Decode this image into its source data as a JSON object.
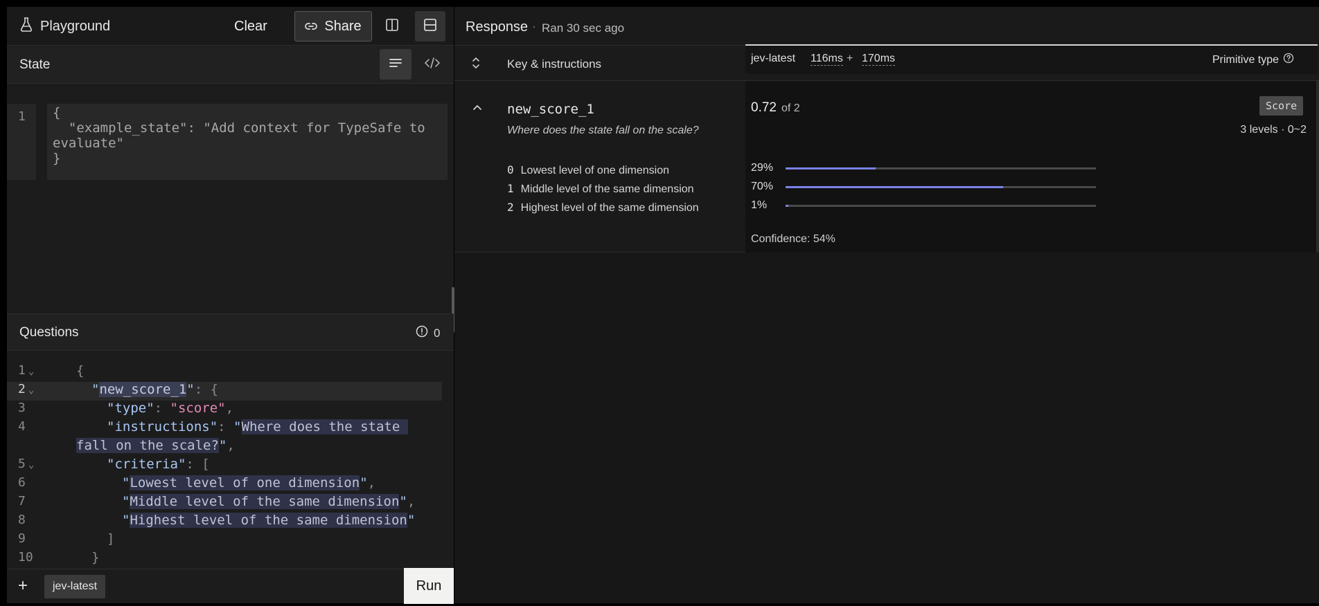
{
  "topbar": {
    "app_title": "Playground",
    "clear_label": "Clear",
    "share_label": "Share"
  },
  "state": {
    "title": "State",
    "line_number": "1",
    "lines": [
      "{",
      "  \"example_state\": \"Add context for TypeSafe to",
      "evaluate\"",
      "}"
    ]
  },
  "questions": {
    "title": "Questions",
    "issue_count": "0",
    "line_numbers": [
      "1",
      "2",
      "3",
      "4",
      "",
      "5",
      "6",
      "7",
      "8",
      "9",
      "10"
    ]
  },
  "bottombar": {
    "add_label": "+",
    "model_chip": "jev-latest",
    "run_label": "Run"
  },
  "response": {
    "title": "Response",
    "separator": "·",
    "ran": "Ran 30 sec ago",
    "key_header": "Key & instructions",
    "model_name": "jev-latest",
    "latency_a": "116ms",
    "latency_plus": "+",
    "latency_b": "170ms",
    "primitive_type_label": "Primitive type"
  },
  "question_row": {
    "key": "new_score_1",
    "instructions": "Where does the state fall on the scale?",
    "criteria": [
      {
        "index": "0",
        "label": "Lowest level of one dimension"
      },
      {
        "index": "1",
        "label": "Middle level of the same dimension"
      },
      {
        "index": "2",
        "label": "Highest level of the same dimension"
      }
    ],
    "score_value": "0.72",
    "score_of": "of 2",
    "badge": "Score",
    "levels_text": "3 levels · 0~2",
    "distribution": [
      {
        "label": "29%",
        "value": 0.29
      },
      {
        "label": "70%",
        "value": 0.7
      },
      {
        "label": "1%",
        "value": 0.01
      }
    ],
    "confidence": "Confidence: 54%"
  },
  "colors": {
    "accent_bar": "#7b83e8",
    "string": "#e58ab4",
    "key": "#a9c7f5"
  }
}
